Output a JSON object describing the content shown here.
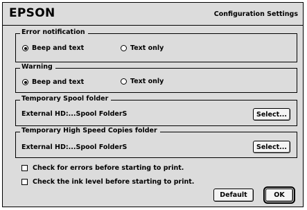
{
  "header": {
    "brand": "EPSON",
    "title": "Configuration Settings"
  },
  "error_notification": {
    "label": "Error notification",
    "options": [
      {
        "label": "Beep and text",
        "selected": true
      },
      {
        "label": "Text only",
        "selected": false
      }
    ]
  },
  "warning": {
    "label": "Warning",
    "options": [
      {
        "label": "Beep and text",
        "selected": true
      },
      {
        "label": "Text only",
        "selected": false
      }
    ]
  },
  "spool_folder": {
    "label": "Temporary Spool folder",
    "path": "External HD:...Spool FolderS",
    "button": "Select..."
  },
  "high_speed_folder": {
    "label": "Temporary High Speed Copies folder",
    "path": "External HD:...Spool FolderS",
    "button": "Select..."
  },
  "options": {
    "check_errors": {
      "label": "Check for errors before starting to print.",
      "checked": false
    },
    "check_ink": {
      "label": "Check the ink level before starting to print.",
      "checked": false
    }
  },
  "footer": {
    "default_button": "Default",
    "ok_button": "OK"
  }
}
